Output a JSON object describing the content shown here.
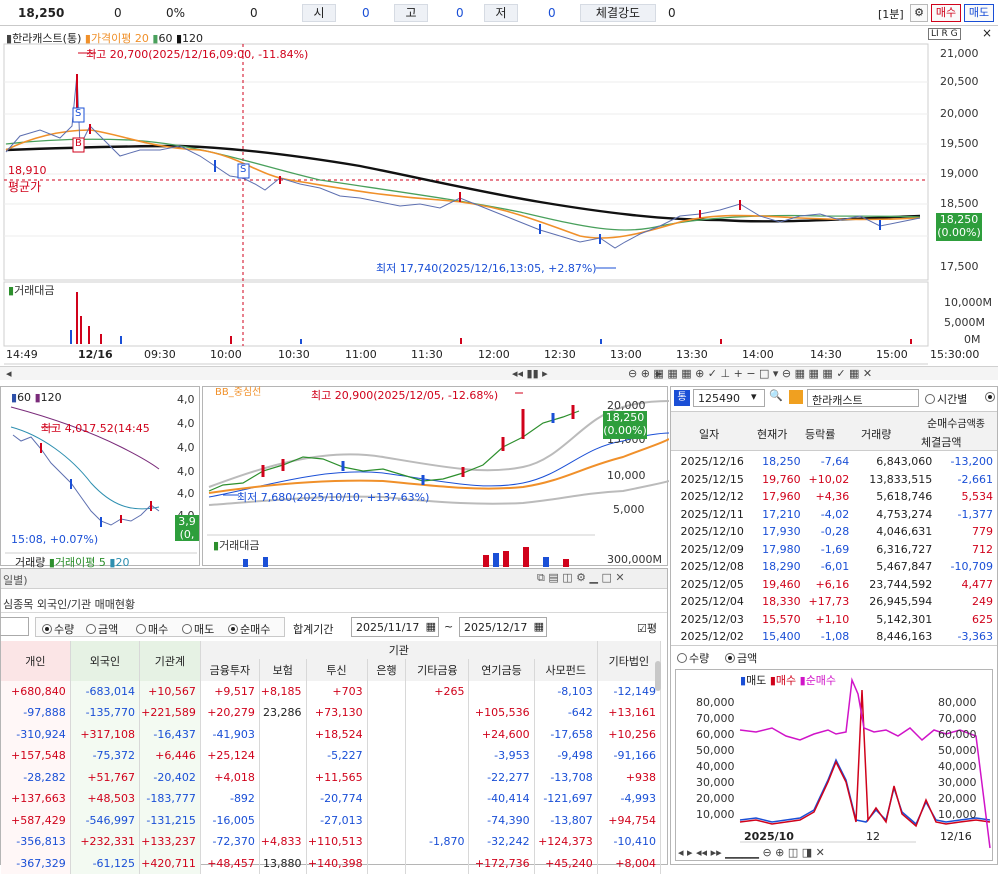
{
  "top": {
    "price": "18,250",
    "change": "0",
    "pct": "0%",
    "volume": "0",
    "open_label": "시",
    "open_value": "0",
    "high_label": "고",
    "high_value": "0",
    "low_label": "저",
    "low_value": "0",
    "strength_label": "체결강도",
    "strength_value": "0",
    "interval": "[1분]",
    "buy": "매수",
    "sell": "매도"
  },
  "main": {
    "title": "한라캐스트(통)",
    "legend_ma": "가격이평 20",
    "legend_60": "60",
    "legend_120": "120",
    "high_note": "최고 20,700(2025/12/16,09:00, -11.84%)",
    "low_note": "최저 17,740(2025/12/16,13:05, +2.87%)",
    "avg_price": "18,910",
    "avg_label": "평균가",
    "last_price": "18,250",
    "last_pct": "(0.00%)",
    "y_ticks": [
      "21,000",
      "20,500",
      "20,000",
      "19,500",
      "19,000",
      "18,500",
      "17,500"
    ],
    "vol_title": "거래대금",
    "vol_ticks": [
      "10,000M",
      "5,000M",
      "0M"
    ],
    "x_ticks": [
      "14:49",
      "12/16",
      "09:30",
      "10:00",
      "10:30",
      "11:00",
      "11:30",
      "12:00",
      "12:30",
      "13:00",
      "13:30",
      "14:00",
      "14:30",
      "15:00",
      "15:30:00"
    ],
    "s_mark": "S",
    "b_mark": "B"
  },
  "mini": {
    "legend_60": "60",
    "legend_120": "120",
    "high_note": "최고 4,017.52(14:45",
    "low_note": "15:08, +0.07%)",
    "y_ticks": [
      "4,0",
      "4,0",
      "4,0",
      "4,0",
      "4,0",
      "4,0"
    ],
    "pill_top": "3,9",
    "pill_bot": "(0,",
    "vol_legend_a": "거래량",
    "vol_legend_b": "거래이평 5",
    "vol_legend_c": "20"
  },
  "daily": {
    "top_label": "BB_중심선",
    "high_note": "최고 20,900(2025/12/05, -12.68%)",
    "low_note": "최저 7,680(2025/10/10, +137.63%)",
    "y_ticks": [
      "20,000",
      "15,000",
      "10,000",
      "5,000"
    ],
    "last_price": "18,250",
    "last_pct": "(0.00%)",
    "vol_title": "거래대금",
    "vol_tick": "300,000M"
  },
  "investor": {
    "window_title": "일별)",
    "sub_title": "심종목 외국인/기관 매매현황",
    "radio_qty": "수량",
    "radio_amt": "금액",
    "radio_buy": "매수",
    "radio_sell": "매도",
    "radio_net": "순매수",
    "period_label": "합계기간",
    "date_from": "2025/11/17",
    "tilde": "~",
    "date_to": "2025/12/17",
    "check_label": "평",
    "group_header": "기관",
    "columns": [
      "개인",
      "외국인",
      "기관계",
      "금융투자",
      "보험",
      "투신",
      "은행",
      "기타금융",
      "연기금등",
      "사모펀드",
      "기타법인"
    ],
    "rows": [
      [
        "+680,840",
        "-683,014",
        "+10,567",
        "+9,517",
        "+8,185",
        "+703",
        "",
        "+265",
        "",
        "-8,103",
        "-12,149"
      ],
      [
        "-97,888",
        "-135,770",
        "+221,589",
        "+20,279",
        "23,286",
        "+73,130",
        "",
        "",
        "+105,536",
        "-642",
        "+13,161"
      ],
      [
        "-310,924",
        "+317,108",
        "-16,437",
        "-41,903",
        "",
        "+18,524",
        "",
        "",
        "+24,600",
        "-17,658",
        "+10,256"
      ],
      [
        "+157,548",
        "-75,372",
        "+6,446",
        "+25,124",
        "",
        "-5,227",
        "",
        "",
        "-3,953",
        "-9,498",
        "-91,166"
      ],
      [
        "-28,282",
        "+51,767",
        "-20,402",
        "+4,018",
        "",
        "+11,565",
        "",
        "",
        "-22,277",
        "-13,708",
        "+938"
      ],
      [
        "+137,663",
        "+48,503",
        "-183,777",
        "-892",
        "",
        "-20,774",
        "",
        "",
        "-40,414",
        "-121,697",
        "-4,993"
      ],
      [
        "+587,429",
        "-546,997",
        "-131,215",
        "-16,005",
        "",
        "-27,013",
        "",
        "",
        "-74,390",
        "-13,807",
        "+94,754"
      ],
      [
        "-356,813",
        "+232,331",
        "+133,237",
        "-72,370",
        "+4,833",
        "+110,513",
        "",
        "-1,870",
        "-32,242",
        "+124,373",
        "-10,410"
      ],
      [
        "-367,329",
        "-61,125",
        "+420,711",
        "+48,457",
        "13,880",
        "+140,398",
        "",
        "",
        "+172,736",
        "+45,240",
        "+8,004"
      ]
    ]
  },
  "right": {
    "code": "125490",
    "name": "한라캐스트",
    "radio_time": "시간별",
    "headers": [
      "일자",
      "현재가",
      "등락률",
      "거래량",
      "순매수금액종",
      "체결금액"
    ],
    "h_net": "순매수",
    "h_net2": "금액종",
    "h_exec": "체결금액",
    "rows": [
      [
        "2025/12/16",
        "18,250",
        "-7,64",
        "6,843,060",
        "-13,200"
      ],
      [
        "2025/12/15",
        "19,760",
        "+10,02",
        "13,833,515",
        "-2,661"
      ],
      [
        "2025/12/12",
        "17,960",
        "+4,36",
        "5,618,746",
        "5,534"
      ],
      [
        "2025/12/11",
        "17,210",
        "-4,02",
        "4,753,274",
        "-1,377"
      ],
      [
        "2025/12/10",
        "17,930",
        "-0,28",
        "4,046,631",
        "779"
      ],
      [
        "2025/12/09",
        "17,980",
        "-1,69",
        "6,316,727",
        "712"
      ],
      [
        "2025/12/08",
        "18,290",
        "-6,01",
        "5,467,847",
        "-10,709"
      ],
      [
        "2025/12/05",
        "19,460",
        "+6,16",
        "23,744,592",
        "4,477"
      ],
      [
        "2025/12/04",
        "18,330",
        "+17,73",
        "26,945,594",
        "249"
      ],
      [
        "2025/12/03",
        "15,570",
        "+1,10",
        "5,142,301",
        "625"
      ],
      [
        "2025/12/02",
        "15,400",
        "-1,08",
        "8,446,163",
        "-3,363"
      ]
    ],
    "radio_qty": "수량",
    "radio_amt": "금액",
    "legend_sell": "매도",
    "legend_buy": "매수",
    "legend_net": "순매수",
    "y_ticks": [
      "80,000",
      "70,000",
      "60,000",
      "50,000",
      "40,000",
      "30,000",
      "20,000",
      "10,000"
    ],
    "x_left": "2025/10",
    "x_mid": "12",
    "x_right": "12/16"
  },
  "colors": {
    "up": "#d0021b",
    "down": "#1a4fd6",
    "accent_green": "#2e9e3c",
    "ma20": "#f0902a",
    "ma60": "#49a05c",
    "ma120": "#111111"
  }
}
